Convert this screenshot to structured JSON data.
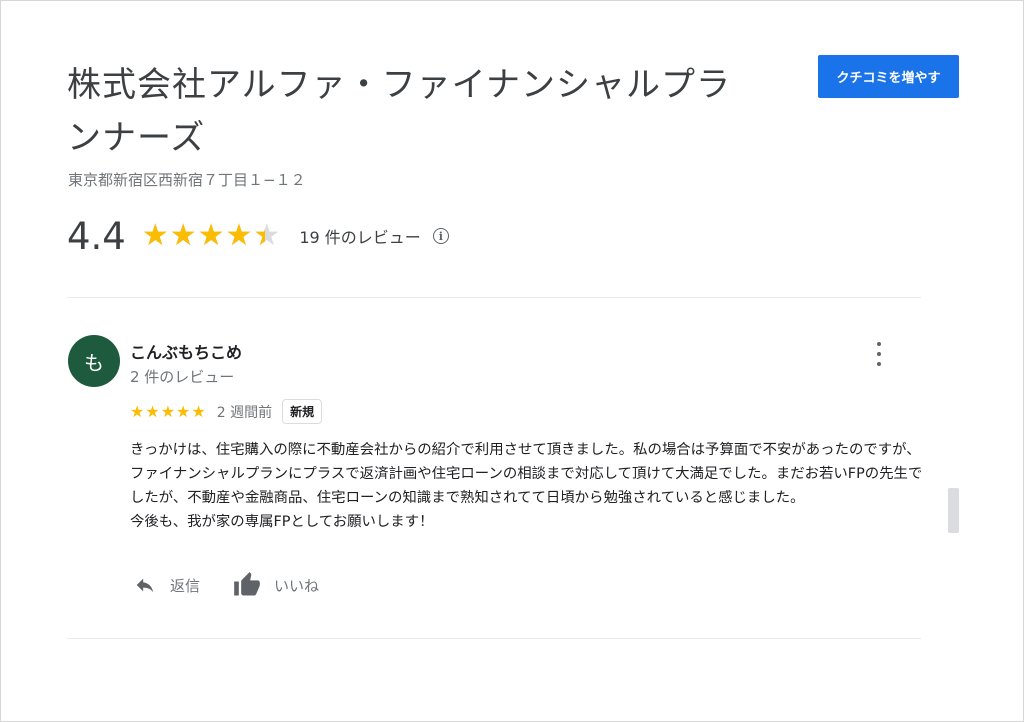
{
  "business": {
    "name": "株式会社アルファ・ファイナンシャルプランナーズ",
    "address": "東京都新宿区西新宿７丁目１−１２",
    "add_review_button": "クチコミを増やす"
  },
  "rating": {
    "score": "4.4",
    "stars_fraction": 0.88,
    "stars_glyphs": "★★★★★",
    "review_count_text": "19 件のレビュー",
    "info_icon": "i"
  },
  "review": {
    "avatar_letter": "も",
    "avatar_color": "#1e5a3e",
    "reviewer_name": "こんぶもちこめ",
    "reviewer_review_count": "2 件のレビュー",
    "stars": "★★★★★",
    "time": "2 週間前",
    "badge": "新規",
    "text": "きっかけは、住宅購入の際に不動産会社からの紹介で利用させて頂きました。私の場合は予算面で不安があったのですが、ファイナンシャルプランにプラスで返済計画や住宅ローンの相談まで対応して頂けて大満足でした。まだお若いFPの先生でしたが、不動産や金融商品、住宅ローンの知識まで熟知されてて日頃から勉強されていると感じました。\n今後も、我が家の専属FPとしてお願いします！",
    "reply_label": "返信",
    "like_label": "いいね"
  },
  "colors": {
    "accent": "#1a73e8",
    "star": "#fbbc04",
    "star_empty": "#dadce0"
  }
}
